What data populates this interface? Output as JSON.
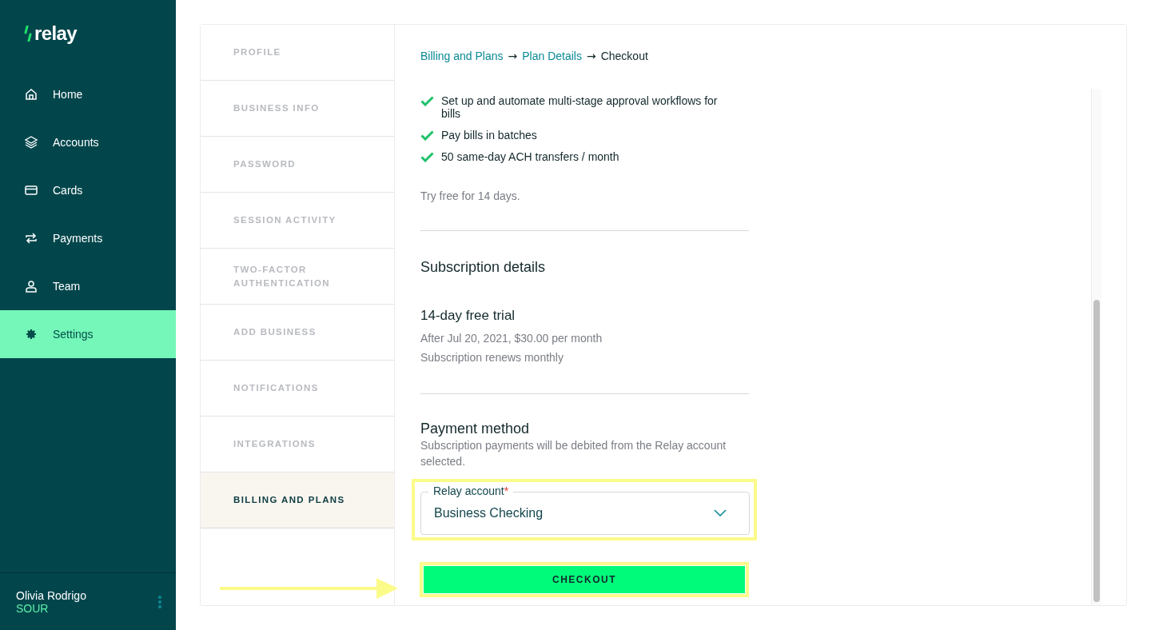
{
  "sidebar": {
    "logo": "relay",
    "items": [
      {
        "label": "Home",
        "kind": "home",
        "selected": false
      },
      {
        "label": "Accounts",
        "kind": "layers",
        "selected": false
      },
      {
        "label": "Cards",
        "kind": "card",
        "selected": false
      },
      {
        "label": "Payments",
        "kind": "arrows",
        "selected": false
      },
      {
        "label": "Team",
        "kind": "user",
        "selected": false
      },
      {
        "label": "Settings",
        "kind": "gear",
        "selected": true
      }
    ],
    "user": {
      "name": "Olivia Rodrigo",
      "business": "SOUR"
    }
  },
  "settings_tabs": [
    {
      "label": "PROFILE",
      "selected": false
    },
    {
      "label": "BUSINESS INFO",
      "selected": false
    },
    {
      "label": "PASSWORD",
      "selected": false
    },
    {
      "label": "SESSION ACTIVITY",
      "selected": false
    },
    {
      "label": "TWO-FACTOR AUTHENTICATION",
      "selected": false
    },
    {
      "label": "ADD BUSINESS",
      "selected": false
    },
    {
      "label": "NOTIFICATIONS",
      "selected": false
    },
    {
      "label": "INTEGRATIONS",
      "selected": false
    },
    {
      "label": "BILLING AND PLANS",
      "selected": true
    }
  ],
  "breadcrumb": [
    {
      "kind": "link",
      "label": "Billing and Plans"
    },
    {
      "kind": "separator",
      "label": "→"
    },
    {
      "kind": "link",
      "label": "Plan Details"
    },
    {
      "kind": "separator",
      "label": "→"
    },
    {
      "kind": "current",
      "label": "Checkout"
    }
  ],
  "features": [
    "Set up and automate multi-stage approval workflows for bills",
    "Pay bills in batches",
    "50 same-day ACH transfers / month"
  ],
  "trial_note": "Try free for 14 days.",
  "subscription": {
    "heading": "Subscription details",
    "plan": "14-day free trial",
    "lines": [
      "After Jul 20, 2021, $30.00 per month",
      "Subscription renews monthly"
    ]
  },
  "payment": {
    "heading": "Payment method",
    "description": "Subscription payments will be debited from the Relay account selected.",
    "field": {
      "label": "Relay account",
      "required_mark": "*",
      "value": "Business Checking"
    }
  },
  "checkout_button": "CHECKOUT"
}
